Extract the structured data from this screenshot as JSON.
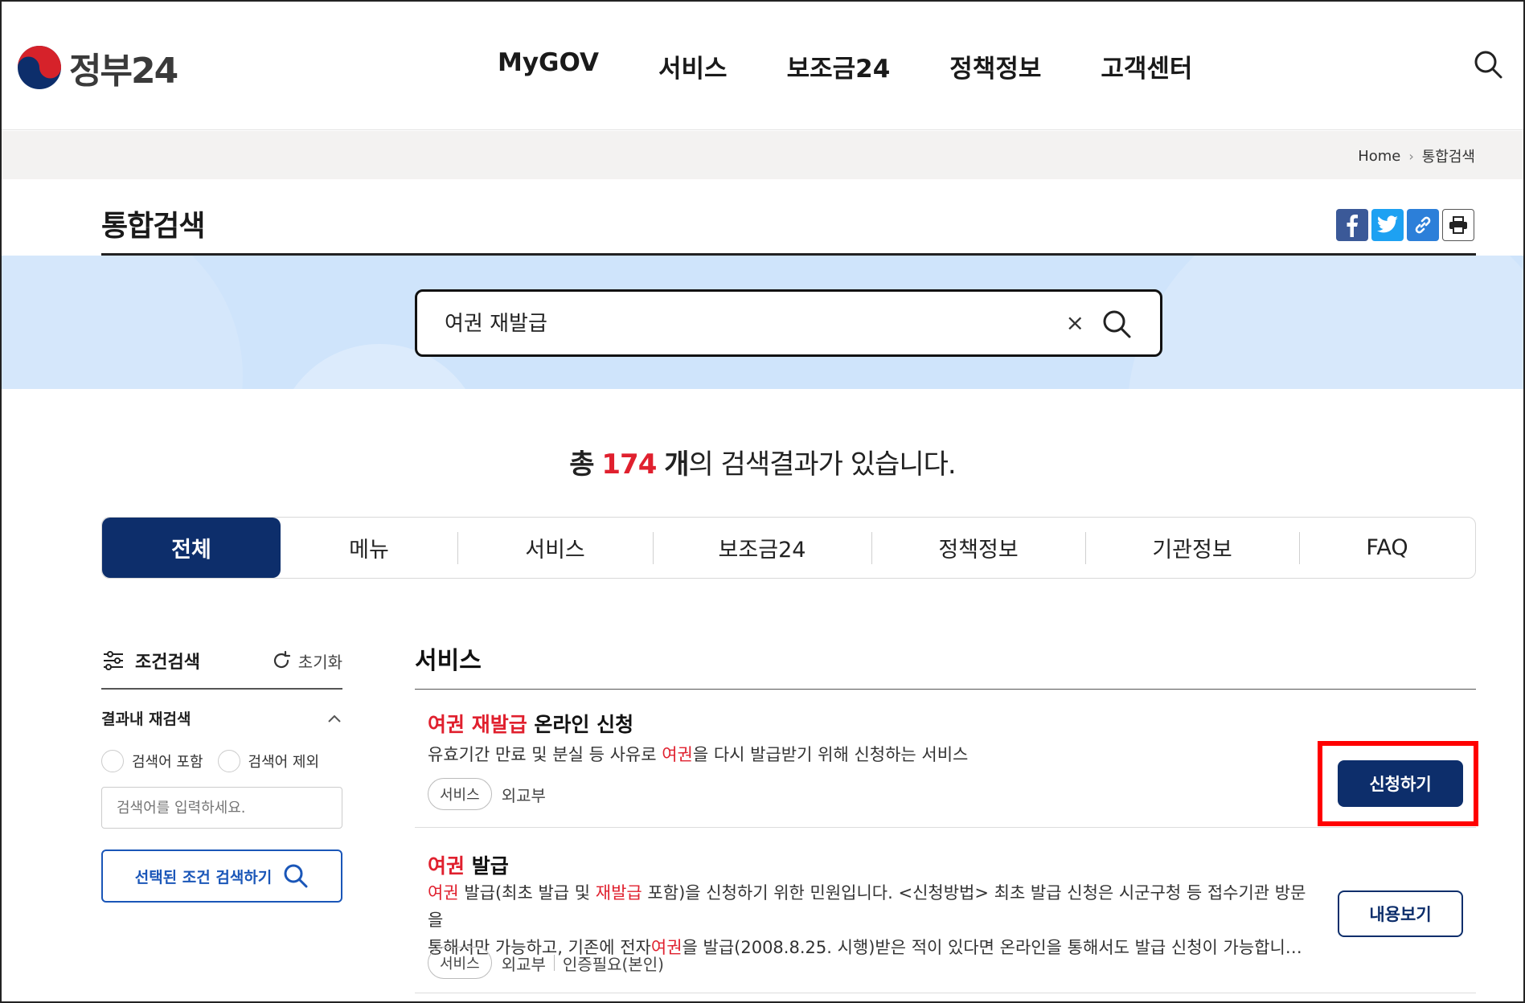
{
  "header": {
    "logo_text": "정부24",
    "nav": [
      "MyGOV",
      "서비스",
      "보조금24",
      "정책정보",
      "고객센터"
    ]
  },
  "breadcrumb": {
    "home": "Home",
    "current": "통합검색"
  },
  "page": {
    "title": "통합검색"
  },
  "search": {
    "query": "여권 재발급",
    "clear_label": "×"
  },
  "result_count": {
    "prefix": "총",
    "count": "174",
    "unit": "개",
    "suffix": "의 검색결과가 있습니다."
  },
  "tabs": [
    "전체",
    "메뉴",
    "서비스",
    "보조금24",
    "정책정보",
    "기관정보",
    "FAQ"
  ],
  "filter": {
    "title": "조건검색",
    "reset": "초기화",
    "refine_title": "결과내 재검색",
    "include_label": "검색어 포함",
    "exclude_label": "검색어 제외",
    "placeholder": "검색어를 입력하세요.",
    "submit": "선택된 조건 검색하기"
  },
  "results": {
    "section_title": "서비스",
    "items": [
      {
        "title_hl": "여권 재발급",
        "title_rest": " 온라인 신청",
        "desc_a": "유효기간 만료 및 분실 등 사유로 ",
        "desc_hl": "여권",
        "desc_b": "을 다시 발급받기 위해 신청하는 서비스",
        "chip": "서비스",
        "org": "외교부",
        "button": "신청하기"
      },
      {
        "title_hl": "여권",
        "title_rest": " 발급",
        "line1_hl1": "여권",
        "line1_a": " 발급(최초 발급 및 ",
        "line1_hl2": "재발급",
        "line1_b": " 포함)을 신청하기 위한 민원입니다. <신청방법> 최초 발급 신청은 시군구청 등 접수기관 방문을",
        "line2_a": "통해서만 가능하고, 기존에 전자",
        "line2_hl": "여권",
        "line2_b": "을 발급(2008.8.25. 시행)받은 적이 있다면 온라인을 통해서도 발급 신청이 가능합니…",
        "chip": "서비스",
        "org": "외교부",
        "auth": "인증필요(본인)",
        "button": "내용보기"
      }
    ]
  },
  "colors": {
    "primary": "#0d2e6b",
    "highlight": "#e0202e",
    "band": "#cfe4fb",
    "annotation": "#ff0000"
  }
}
